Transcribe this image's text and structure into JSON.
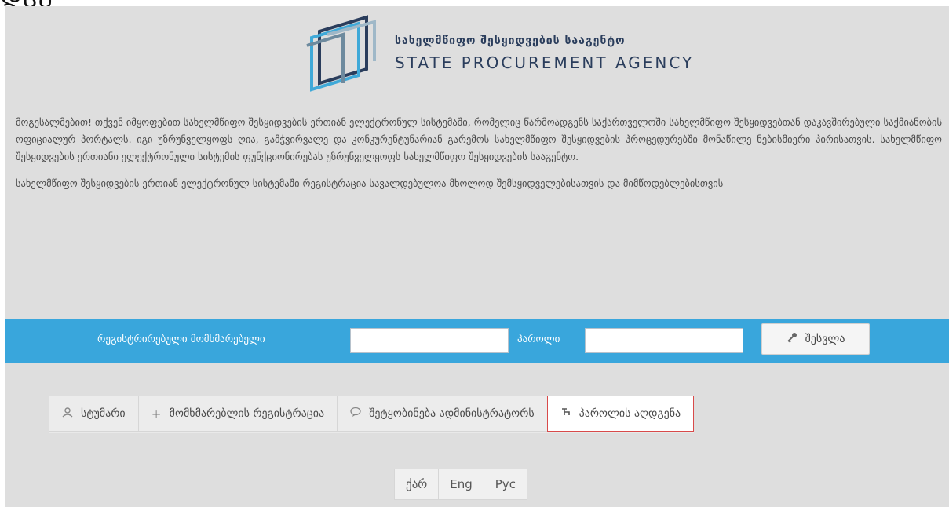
{
  "corner_text": "ᲓᲡᲛ",
  "logo": {
    "name_ka": "სახელმწიფო შესყიდვების სააგენტო",
    "name_en": "STATE PROCUREMENT AGENCY",
    "colors": [
      "#2a3d5c",
      "#3fa9d8"
    ]
  },
  "intro": {
    "p1": "მოგესალმებით! თქვენ იმყოფებით სახელმწიფო შესყიდვების ერთიან ელექტრონულ სისტემაში, რომელიც წარმოადგენს საქართველოში სახელმწიფო შესყიდვებთან დაკავშირებული საქმიანობის ოფიციალურ პორტალს. იგი უზრუნველყოფს ღია, გამჭვირვალე და კონკურენტუნარიან გარემოს სახელმწიფო შესყიდვების პროცედურებში მონაწილე ნებისმიერი პირისათვის. სახელმწიფო შესყიდვების ერთიანი ელექტრონული სისტემის ფუნქციონირებას უზრუნველყოფს სახელმწიფო შესყიდვების სააგენტო.",
    "p2": "სახელმწიფო შესყიდვების ერთიან ელექტრონულ სისტემაში რეგისტრაცია სავალდებულოა მხოლოდ შემსყიდველებისათვის და მიმწოდებლებისთვის"
  },
  "login": {
    "bar_color": "#39a6dc",
    "user_label": "რეგისტრირებული მომხმარებელი",
    "user_value": "",
    "password_label": "პაროლი",
    "password_value": "",
    "submit_label": "შესვლა",
    "submit_icon": "key-icon"
  },
  "actions": [
    {
      "label": "სტუმარი",
      "icon": "user-icon"
    },
    {
      "label": "მომხმარებლის რეგისტრაცია",
      "icon": "plus-icon"
    },
    {
      "label": "შეტყობინება ადმინისტრატორს",
      "icon": "comment-icon"
    },
    {
      "label": "პაროლის აღდგენა",
      "icon": "restore-icon",
      "active": true
    }
  ],
  "languages": [
    "ქარ",
    "Eng",
    "Рус"
  ]
}
